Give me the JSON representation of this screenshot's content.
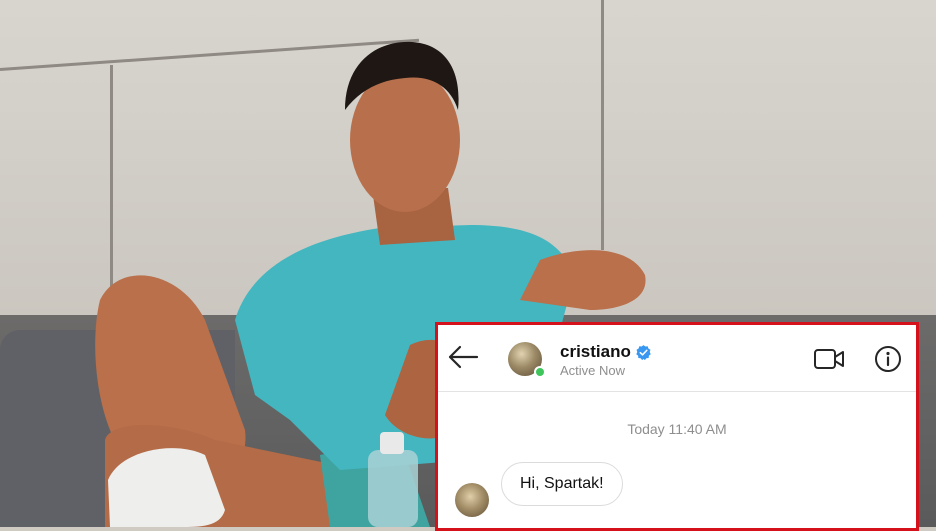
{
  "conversation": {
    "username": "cristiano",
    "verified": true,
    "status": "Active Now",
    "timestamp": "Today 11:40 AM",
    "messages": [
      {
        "sender": "cristiano",
        "text": "Hi, Spartak!"
      }
    ]
  },
  "icons": {
    "back": "arrow-left-icon",
    "verified": "verified-badge-icon",
    "video": "video-camera-icon",
    "info": "info-icon"
  },
  "colors": {
    "highlight_border": "#d5121b",
    "verified_blue": "#3897f0",
    "online_green": "#3fc55c"
  }
}
